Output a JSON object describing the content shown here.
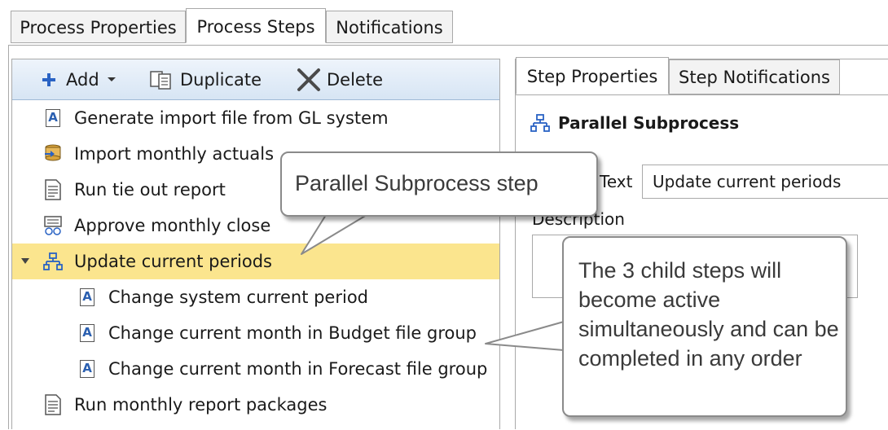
{
  "top_tabs": [
    "Process Properties",
    "Process Steps",
    "Notifications"
  ],
  "active_top_tab": "Process Steps",
  "toolbar": {
    "add_label": "Add",
    "duplicate_label": "Duplicate",
    "delete_label": "Delete"
  },
  "steps": [
    {
      "label": "Generate import file from GL system",
      "icon": "text-step-icon",
      "level": 0
    },
    {
      "label": "Import monthly actuals",
      "icon": "import-data-icon",
      "level": 0
    },
    {
      "label": "Run tie out report",
      "icon": "report-icon",
      "level": 0
    },
    {
      "label": "Approve monthly close",
      "icon": "approval-icon",
      "level": 0
    },
    {
      "label": "Update current periods",
      "icon": "parallel-subprocess-icon",
      "level": 0,
      "selected": true,
      "expanded": true
    },
    {
      "label": "Change system current period",
      "icon": "text-step-icon",
      "level": 1
    },
    {
      "label": "Change current month in Budget file group",
      "icon": "text-step-icon",
      "level": 1
    },
    {
      "label": "Change current month in Forecast file group",
      "icon": "text-step-icon",
      "level": 1
    },
    {
      "label": "Run monthly report packages",
      "icon": "report-icon",
      "level": 0
    }
  ],
  "right_tabs": [
    "Step Properties",
    "Step Notifications"
  ],
  "active_right_tab": "Step Properties",
  "step_properties": {
    "type_title": "Parallel Subprocess",
    "text_label": "Text",
    "text_value": "Update current periods",
    "description_label": "Description"
  },
  "callouts": {
    "parallel_step": "Parallel Subprocess step",
    "child_steps": "The 3 child steps will become active simultaneously and can be completed in any order"
  },
  "colors": {
    "selected_row": "#fbe58e",
    "toolbar_top": "#eef4fb",
    "toolbar_bottom": "#d7e5f4",
    "accent_icon": "#2a5fb0"
  }
}
